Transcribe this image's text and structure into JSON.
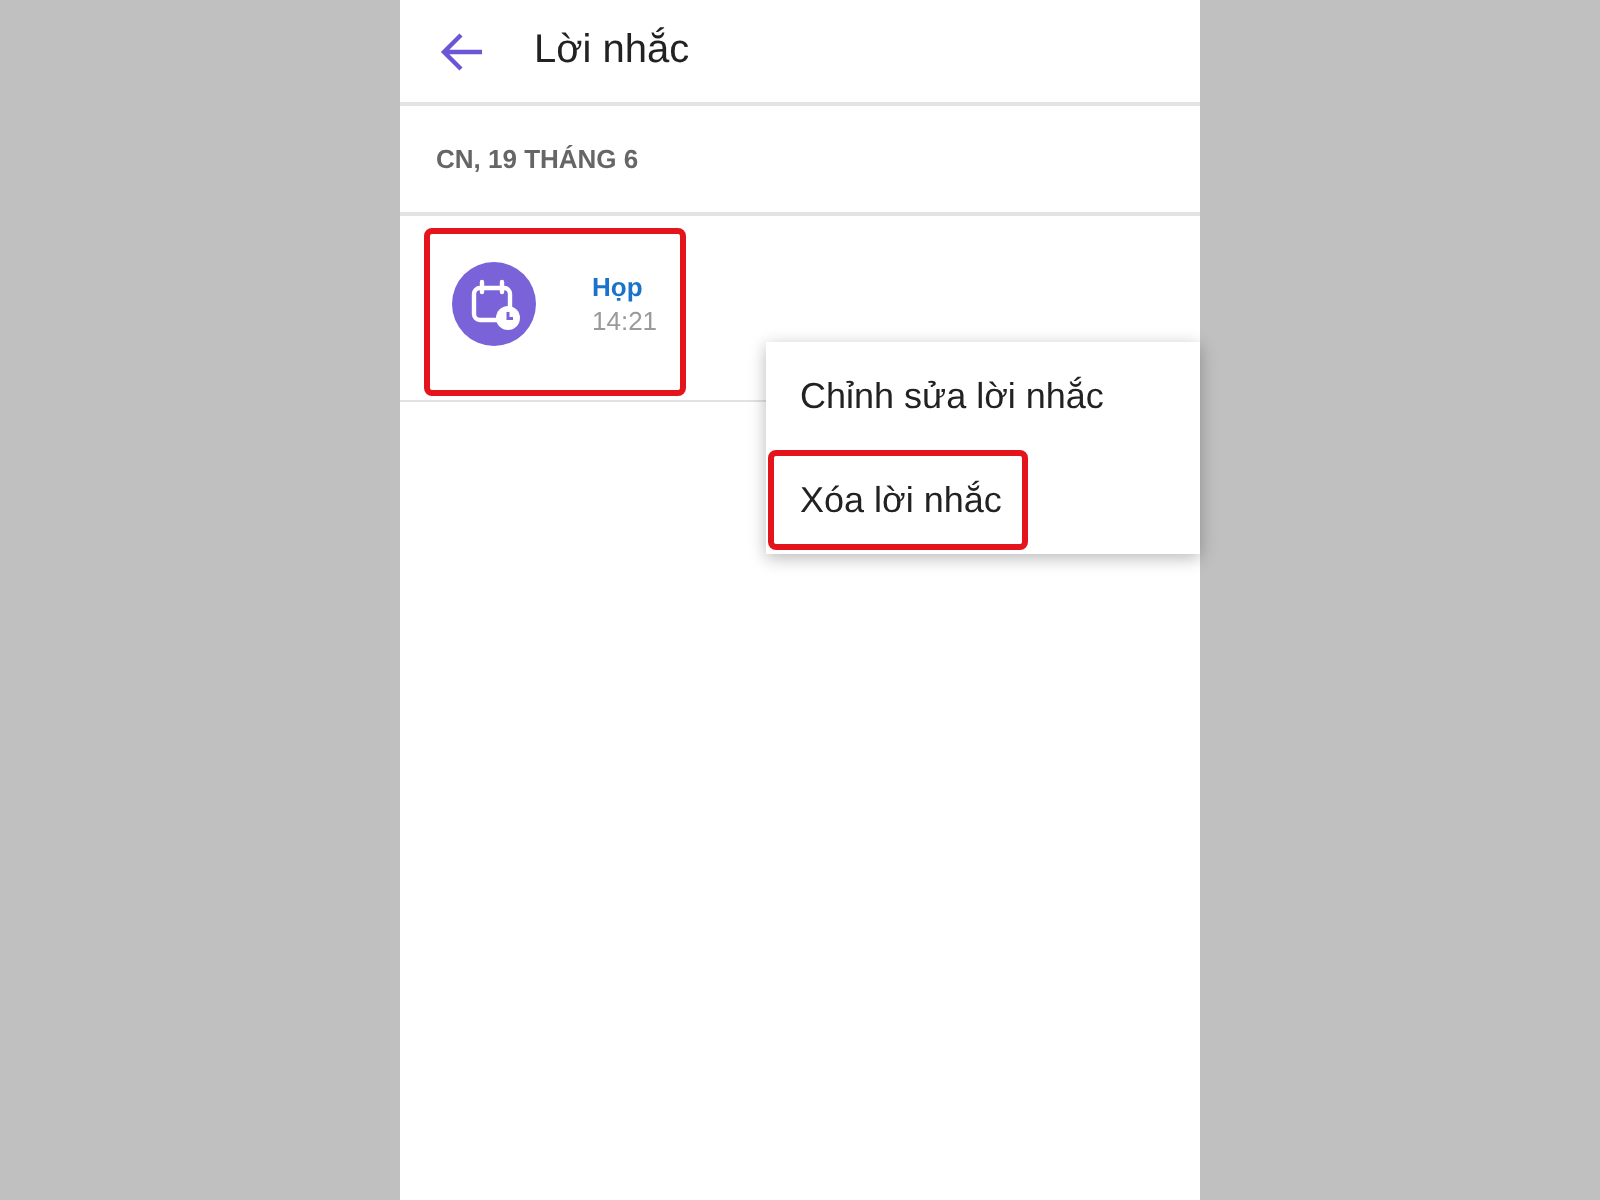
{
  "header": {
    "title": "Lời nhắc"
  },
  "sections": [
    {
      "date": "CN, 19 THÁNG 6",
      "reminders": [
        {
          "title": "Họp",
          "time": "14:21",
          "highlighted": true
        }
      ]
    }
  ],
  "context_menu": {
    "items": [
      {
        "label": "Chỉnh sửa lời nhắc",
        "highlighted": false
      },
      {
        "label": "Xóa lời nhắc",
        "highlighted": true
      }
    ]
  }
}
